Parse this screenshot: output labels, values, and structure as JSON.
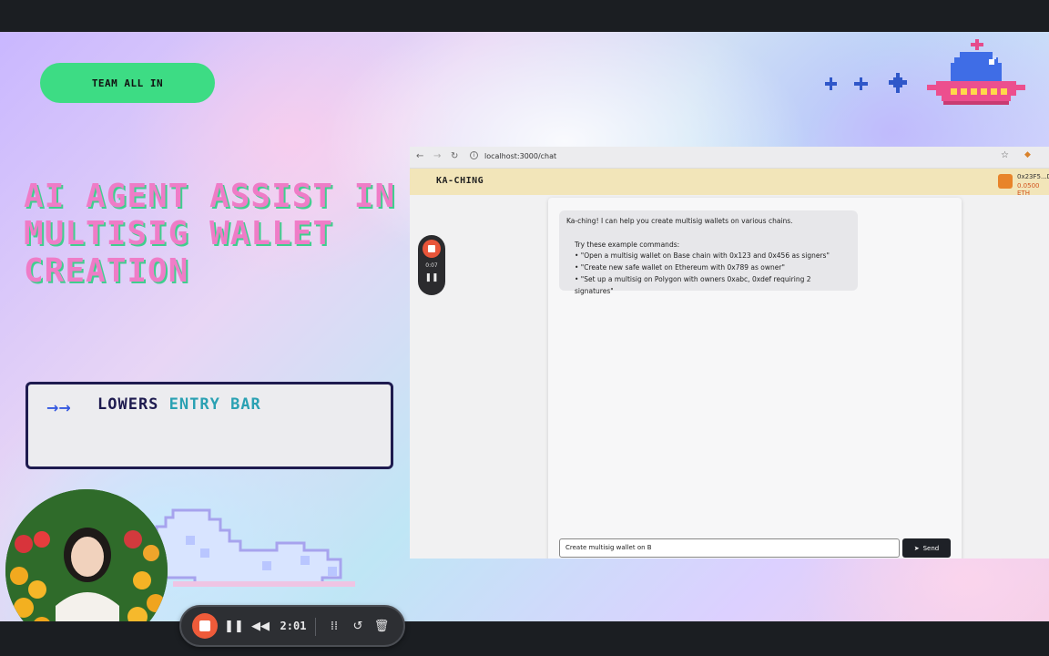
{
  "slide": {
    "team_label": "TEAM ALL IN",
    "title": "AI AGENT ASSIST IN MULTISIG WALLET CREATION",
    "info_arrow": "→→",
    "info_word1": "LOWERS",
    "info_word2": "ENTRY BAR"
  },
  "browser": {
    "url": "localhost:3000/chat",
    "app_name": "KA-CHING",
    "account_address": "0x23F5...D",
    "account_balance": "0.0500 ETH"
  },
  "chat": {
    "message_lines": [
      "Ka-ching! I can help you create multisig wallets on various chains.",
      "Try these example commands:",
      "• \"Open a multisig wallet on Base chain with 0x123 and 0x456 as signers\"",
      "• \"Create new safe wallet on Ethereum with 0x789 as owner\"",
      "• \"Set up a multisig on Polygon with owners 0xabc, 0xdef requiring 2 signatures\""
    ],
    "input_value": "Create multisig wallet on B",
    "send_label": "Send"
  },
  "mini_recorder": {
    "time": "0:07"
  },
  "recorder": {
    "time": "2:01"
  },
  "icons": {
    "recorder": [
      "stop-icon",
      "pause-icon",
      "rewind-icon",
      "grid-icon",
      "restart-icon",
      "trash-icon"
    ],
    "browser": [
      "back-icon",
      "forward-icon",
      "reload-icon",
      "site-info-icon",
      "bookmark-star-icon",
      "extension-icon"
    ]
  },
  "colors": {
    "title_pink": "#ef7cc7",
    "title_shadow_green": "#3fcf8e",
    "team_pill_green": "#3ddc84",
    "box_border_navy": "#1e1b4f",
    "app_header": "#f2e5b9",
    "record_red": "#ef5b3a"
  }
}
